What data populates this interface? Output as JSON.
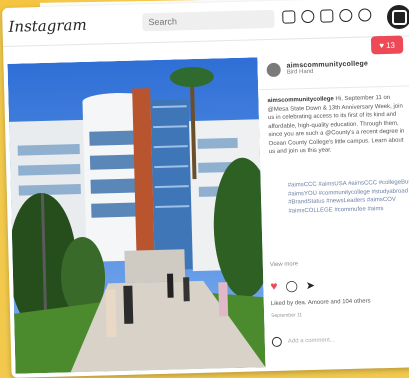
{
  "topbar": {
    "logo": "Instagram",
    "search_placeholder": "Search"
  },
  "notifications": {
    "likes_count": "13"
  },
  "post": {
    "author_handle": "aimscommunitycollege",
    "location": "Bird Hand",
    "caption_handle": "aimscommunitycollege",
    "caption_text": "Hi, September 11 on @Mesa State Down & 13th Anniversary Week, join us in celebrating access to its first of its kind and affordable, high-quality education. Through them, since you are such a @County's a recent degree in Ocean County College's little campus. Learn about us and join us this year.",
    "hashtags": "#aimsCCC #aimsUSA #aimsCCC #collegeBuilt #aimsYOU #communitycollege #studyabroad #BrandStatus #newsLeaders #aimsCOV #aimsCOLLEGE #commufee #aims",
    "view_more": "View more",
    "likes_text": "Liked by dea. Amoore and 104 others",
    "timestamp": "September 11"
  },
  "comment": {
    "placeholder": "Add a comment..."
  },
  "icons": [
    "home-icon",
    "explore-icon",
    "messenger-icon",
    "compass-icon",
    "heart-icon",
    "profile-icon"
  ],
  "colors": {
    "accent": "#ed4956",
    "backdrop": "#f2c94c",
    "link": "#6b7fa5"
  }
}
